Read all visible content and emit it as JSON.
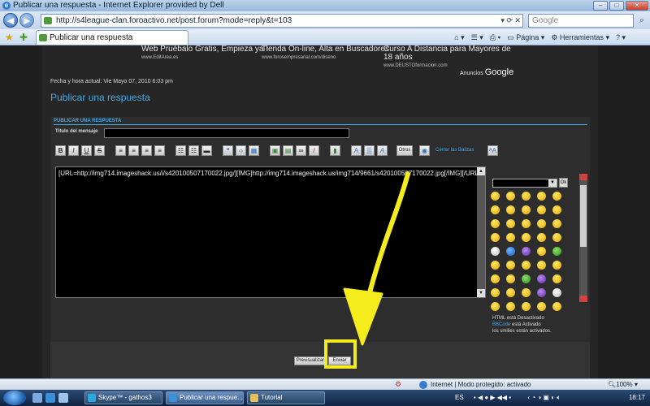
{
  "browser": {
    "window_title": "Publicar una respuesta - Internet Explorer provided by Dell",
    "url": "http://s4league-clan.foroactivo.net/post.forum?mode=reply&t=103",
    "search_placeholder": "Google",
    "tab_title": "Publicar una respuesta",
    "commands": {
      "page": "Página",
      "tools": "Herramientas"
    }
  },
  "ads": [
    {
      "line1": "Web Pruébalo Gratis, Empieza ya !",
      "url": "www.EditArea.es"
    },
    {
      "line1": "Tienda On-line, Alta en Buscadores",
      "url": "www.forosempresarial.com/diseno"
    },
    {
      "line1": "Curso A Distancia para Mayores de",
      "line2": "18 años",
      "url": "www.DEUSTOformacion.com"
    }
  ],
  "ads_label": {
    "prefix": "Anuncios",
    "brand": "Google"
  },
  "page": {
    "datetime": "Fecha y hora actual: Vie Mayo 07, 2010 6:03 pm",
    "title": "Publicar una respuesta",
    "panel_header": "PUBLICAR UNA RESPUESTA",
    "subject_label": "Título del mensaje",
    "toolbar": {
      "bold": "B",
      "italic": "I",
      "underline": "U",
      "strike": "S",
      "otros": "Otros",
      "close_tags": "Cerrar las Balizas"
    },
    "editor_text": "[URL=http://img714.imageshack.us/i/s420100507170022.jpg/][IMG]http://img714.imageshack.us/img714/9661/s420100507170022.jpg[/IMG][/URL]",
    "ok": "Ok",
    "html_status": "HTML está Desactivado",
    "bbcode_link": "BBCode",
    "bbcode_status": "está Activado",
    "smilies_status": "los smilies están activados.",
    "preview_button": "Previsualizar",
    "send_button": "Enviar"
  },
  "statusbar": {
    "zone": "Internet | Modo protegido: activado",
    "zoom": "100%"
  },
  "taskbar": {
    "tasks": [
      "Skype™ - gathos3",
      "Publicar una respue...",
      "Tutorial"
    ],
    "lang": "ES",
    "time": "18:17"
  },
  "colors": {
    "accent": "#46a8e4",
    "annotation": "#f4ec1c"
  }
}
